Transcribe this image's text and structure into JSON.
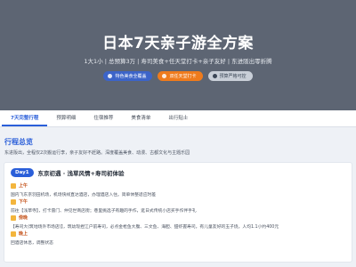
{
  "hero": {
    "title": "日本7天亲子游全方案",
    "subtitle": "1大1小 | 总预算3万 | 寿司美食+任天堂打卡+亲子友好 | 东进阪出零折腾",
    "buttons": [
      {
        "label": "特色美食全覆盖",
        "style": "blue",
        "icon": "food-icon"
      },
      {
        "label": "双任天堂打卡",
        "style": "orange",
        "icon": "game-icon"
      },
      {
        "label": "预算严格可控",
        "style": "light",
        "icon": "wallet-icon"
      }
    ]
  },
  "tabs": [
    {
      "label": "7天完整行程",
      "active": true
    },
    {
      "label": "预算明细",
      "active": false
    },
    {
      "label": "住宿推荐",
      "active": false
    },
    {
      "label": "美食清单",
      "active": false
    },
    {
      "label": "出行贴士",
      "active": false
    }
  ],
  "overview": {
    "title": "行程总览",
    "description": "东进阪出，全程仅2次搬运行李，亲子友好不赶路。深度覆盖美食、动漫、古都文化与主题乐园"
  },
  "day1": {
    "badge": "Day1",
    "title": "东京初遇 · 浅草风情+寿司初体验",
    "segments": [
      {
        "label": "上午",
        "text": "国内飞东京羽田机场，机场快线直达酒店，办理酒店入住。简单休整适应时差"
      },
      {
        "label": "下午",
        "text": "前往【浅草寺】，打卡雷门、仲见世商店街；巷里挑选子有趣的手作，逛日式传统小店买手作伴手礼"
      },
      {
        "label": "傍晚",
        "text": "【寿司大(筑地场外市场店)】，筑幼现捏江户前寿司，必点金枪鱼大腹、三文鱼、海胆、甜虾握寿司，有儿童友好的玉子烧，人均1.1小约400元"
      },
      {
        "label": "晚上",
        "text": "回酒店休息，调整状态"
      }
    ]
  },
  "colors": {
    "accent": "#2b5fd9",
    "orange": "#ef7b1c",
    "hero_bg": "#5d6573"
  }
}
